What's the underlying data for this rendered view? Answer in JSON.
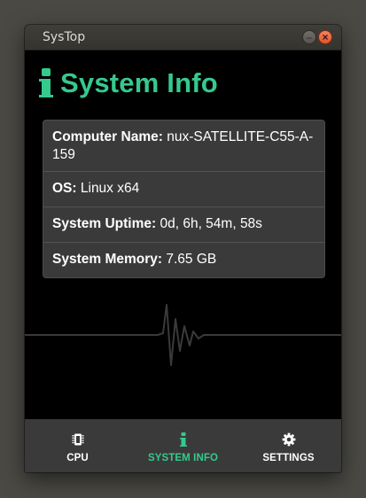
{
  "window": {
    "title": "SysTop",
    "minimize_glyph": "–",
    "close_glyph": "×"
  },
  "header": {
    "icon": "info-icon",
    "title": "System Info",
    "accent_color": "#36c98d"
  },
  "info": {
    "rows": [
      {
        "label": "Computer Name:",
        "value": "nux-SATELLITE-C55-A-159"
      },
      {
        "label": "OS:",
        "value": "Linux x64"
      },
      {
        "label": "System Uptime:",
        "value": "0d, 6h, 54m, 58s"
      },
      {
        "label": "System Memory:",
        "value": "7.65 GB"
      }
    ]
  },
  "nav": {
    "items": [
      {
        "label": "CPU",
        "icon": "cpu-chip-icon",
        "active": false
      },
      {
        "label": "SYSTEM INFO",
        "icon": "info-icon",
        "active": true
      },
      {
        "label": "SETTINGS",
        "icon": "gear-icon",
        "active": false
      }
    ]
  }
}
